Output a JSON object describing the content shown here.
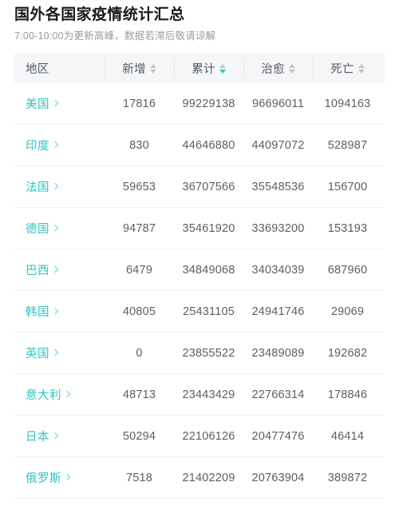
{
  "header": {
    "title": "国外各国家疫情统计汇总",
    "subtitle": "7:00-10:00为更新高峰，数据若滞后敬请谅解"
  },
  "table": {
    "columns": [
      {
        "label": "地区",
        "sortable": false,
        "sort_state": "none"
      },
      {
        "label": "新增",
        "sortable": true,
        "sort_state": "none"
      },
      {
        "label": "累计",
        "sortable": true,
        "sort_state": "desc"
      },
      {
        "label": "治愈",
        "sortable": true,
        "sort_state": "none"
      },
      {
        "label": "死亡",
        "sortable": true,
        "sort_state": "none"
      }
    ],
    "rows": [
      {
        "region": "美国",
        "new": "17816",
        "total": "99229138",
        "cured": "96696011",
        "deaths": "1094163"
      },
      {
        "region": "印度",
        "new": "830",
        "total": "44646880",
        "cured": "44097072",
        "deaths": "528987"
      },
      {
        "region": "法国",
        "new": "59653",
        "total": "36707566",
        "cured": "35548536",
        "deaths": "156700"
      },
      {
        "region": "德国",
        "new": "94787",
        "total": "35461920",
        "cured": "33693200",
        "deaths": "153193"
      },
      {
        "region": "巴西",
        "new": "6479",
        "total": "34849068",
        "cured": "34034039",
        "deaths": "687960"
      },
      {
        "region": "韩国",
        "new": "40805",
        "total": "25431105",
        "cured": "24941746",
        "deaths": "29069"
      },
      {
        "region": "英国",
        "new": "0",
        "total": "23855522",
        "cured": "23489089",
        "deaths": "192682"
      },
      {
        "region": "意大利",
        "new": "48713",
        "total": "23443429",
        "cured": "22766314",
        "deaths": "178846"
      },
      {
        "region": "日本",
        "new": "50294",
        "total": "22106126",
        "cured": "20477476",
        "deaths": "46414"
      },
      {
        "region": "俄罗斯",
        "new": "7518",
        "total": "21402209",
        "cured": "20763904",
        "deaths": "389872"
      }
    ]
  },
  "colors": {
    "accent": "#2fc4c4",
    "header_bg": "#f5f6f7",
    "text": "#595f66",
    "muted": "#9b9b9b",
    "divider": "#f0f2f3"
  }
}
